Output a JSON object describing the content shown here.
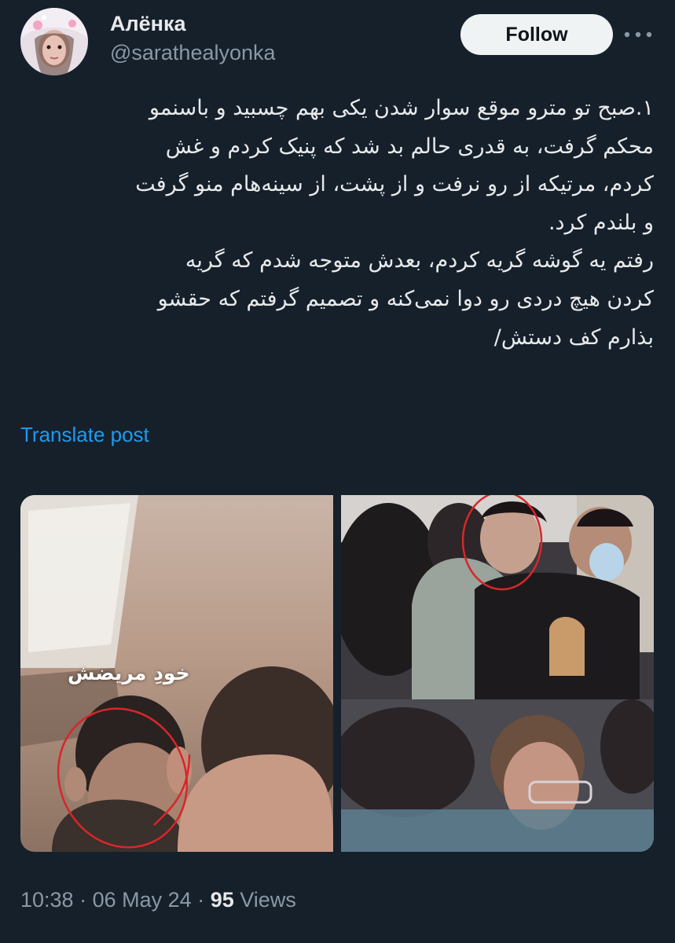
{
  "author": {
    "name": "Алёнка",
    "handle": "@sarathealyonka"
  },
  "follow_label": "Follow",
  "post": {
    "lines": [
      "۱.صبح تو مترو موقع سوار شدن یکی بهم چسبید و باسنمو",
      "محکم گرفت، به قدری حالم بد شد که پنیک کردم و غش",
      "کردم، مرتیکه از رو نرفت و از پشت، از سینه‌هام منو گرفت",
      "و بلندم کرد.",
      "رفتم یه گوشه گریه کردم، بعدش متوجه شدم که گریه",
      "کردن هیچ دردی رو دوا نمی‌کنه و تصمیم گرفتم که حقشو",
      "بذارم کف دستش/"
    ]
  },
  "translate_label": "Translate post",
  "media": {
    "left_caption": "خودِ مریضش"
  },
  "meta": {
    "time": "10:38",
    "date": "06 May 24",
    "sep": "·",
    "views_count": "95",
    "views_label": "Views"
  },
  "colors": {
    "background": "#15202b",
    "link": "#1d9bf0",
    "secondary_text": "#8b98a5",
    "primary_text": "#e7e9ea"
  }
}
